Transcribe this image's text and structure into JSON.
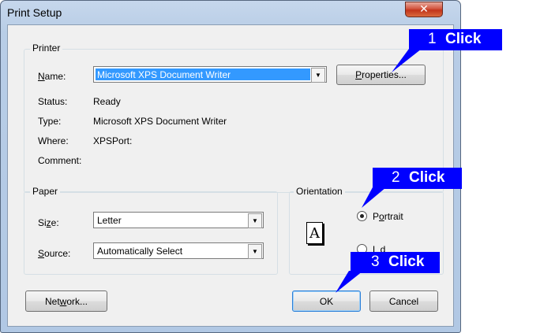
{
  "window": {
    "title": "Print Setup",
    "close_glyph": "✕"
  },
  "printer": {
    "group_label": "Printer",
    "name_label_u": "N",
    "name_label_rest": "ame:",
    "name_value": "Microsoft XPS Document Writer",
    "properties_u": "P",
    "properties_rest": "roperties...",
    "status_label": "Status:",
    "status_value": "Ready",
    "type_label": "Type:",
    "type_value": "Microsoft XPS Document Writer",
    "where_label": "Where:",
    "where_value": "XPSPort:",
    "comment_label": "Comment:"
  },
  "paper": {
    "group_label": "Paper",
    "size_label_a": "Si",
    "size_label_u": "z",
    "size_label_b": "e:",
    "size_value": "Letter",
    "source_label_u": "S",
    "source_label_rest": "ource:",
    "source_value": "Automatically Select"
  },
  "orientation": {
    "group_label": "Orientation",
    "portrait_a": "P",
    "portrait_u": "o",
    "portrait_b": "rtrait",
    "landscape_partial": "L   d   "
  },
  "buttons": {
    "network_a": "Net",
    "network_u": "w",
    "network_b": "ork...",
    "ok": "OK",
    "cancel": "Cancel"
  },
  "callouts": [
    {
      "num": "1",
      "word": "Click"
    },
    {
      "num": "2",
      "word": "Click"
    },
    {
      "num": "3",
      "word": "Click"
    }
  ],
  "colors": {
    "callout": "#0000ff",
    "selection": "#3399ff"
  },
  "icons": {
    "dropdown": "dropdown-arrow-icon",
    "page": "page-a-icon",
    "close": "close-icon"
  }
}
